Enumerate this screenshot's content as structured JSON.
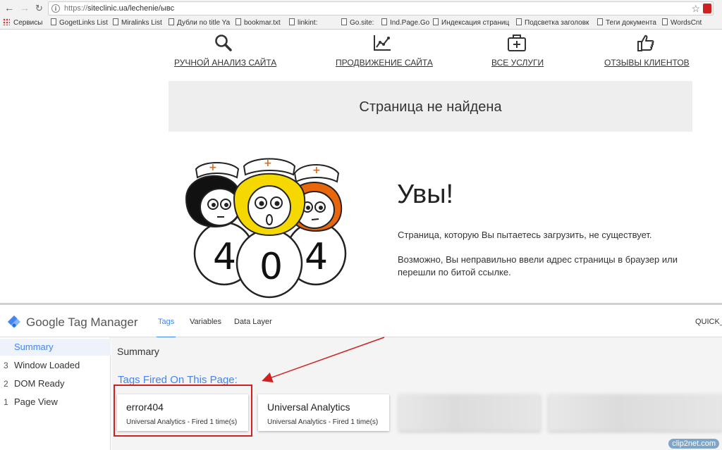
{
  "browser": {
    "url_scheme": "https://",
    "url_rest": "siteclinic.ua/lechenie/ывс",
    "bookmarks": [
      "Сервисы",
      "GogetLinks List",
      "Miralinks List",
      "Дубли no title Ya",
      "bookmar.txt",
      "linkint:",
      "Go.site:",
      "Ind.Page.Go",
      "Индексация страниц",
      "Подсветка заголовк",
      "Теги документа",
      "WordsCnt"
    ]
  },
  "site": {
    "nav": [
      {
        "label": "РУЧНОЙ АНАЛИЗ САЙТА",
        "icon": "search-icon"
      },
      {
        "label": "ПРОДВИЖЕНИЕ САЙТА",
        "icon": "line-chart-icon"
      },
      {
        "label": "ВСЕ УСЛУГИ",
        "icon": "medkit-icon"
      },
      {
        "label": "ОТЗЫВЫ КЛИЕНТОВ",
        "icon": "thumbs-up-icon"
      }
    ],
    "not_found_title": "Страница не найдена",
    "illustration": {
      "digit1": "4",
      "digit2": "0",
      "digit3": "4"
    },
    "heading": "Увы!",
    "text1": "Страница, которую Вы пытаетесь загрузить, не существует.",
    "text2": "Возможно, Вы неправильно ввели адрес страницы в браузер или перешли по битой ссылке."
  },
  "gtm": {
    "brand_google": "Google",
    "brand_product": "Tag Manager",
    "tabs": [
      "Tags",
      "Variables",
      "Data Layer"
    ],
    "active_tab": "Tags",
    "container": "QUICK_",
    "events": [
      {
        "num": "",
        "label": "Summary",
        "active": true
      },
      {
        "num": "3",
        "label": "Window Loaded"
      },
      {
        "num": "2",
        "label": "DOM Ready"
      },
      {
        "num": "1",
        "label": "Page View"
      }
    ],
    "main_title": "Summary",
    "fired_title": "Tags Fired On This Page:",
    "tags": [
      {
        "name": "error404",
        "sub": "Universal Analytics - Fired 1 time(s)"
      },
      {
        "name": "Universal Analytics",
        "sub": "Universal Analytics - Fired 1 time(s)"
      }
    ],
    "colors": {
      "accent": "#4285f4",
      "highlight": "#d02020"
    }
  },
  "watermark": "clip2net.com"
}
